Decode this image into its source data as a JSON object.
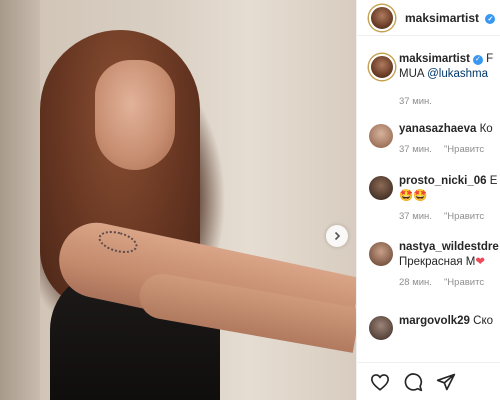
{
  "post": {
    "author": "maksimartist",
    "header_suffix": "•",
    "caption_start": "F",
    "caption_line2_prefix": "MUA ",
    "caption_mention": "@lukashma",
    "caption_time": "37 мин."
  },
  "comments": [
    {
      "user": "yanasazhaeva",
      "text": "Ко",
      "time": "37 мин.",
      "reply": "\"Нравитс"
    },
    {
      "user": "prosto_nicki_06",
      "text": "E",
      "line2": "🤩🤩",
      "time": "37 мин.",
      "reply": "\"Нравитс"
    },
    {
      "user": "nastya_wildestdre",
      "line2_text": "Прекрасная М",
      "line2_heart": "❤",
      "time": "28 мин.",
      "reply": "\"Нравитс"
    },
    {
      "user": "margovolk29",
      "text": "Ско"
    }
  ],
  "icons": [
    "like-icon",
    "comment-icon",
    "share-icon",
    "next-arrow-icon"
  ],
  "colors": {
    "verified": "#3897f0",
    "mention": "#00376b",
    "meta": "#8e8e8e",
    "heart": "#ed4956"
  }
}
